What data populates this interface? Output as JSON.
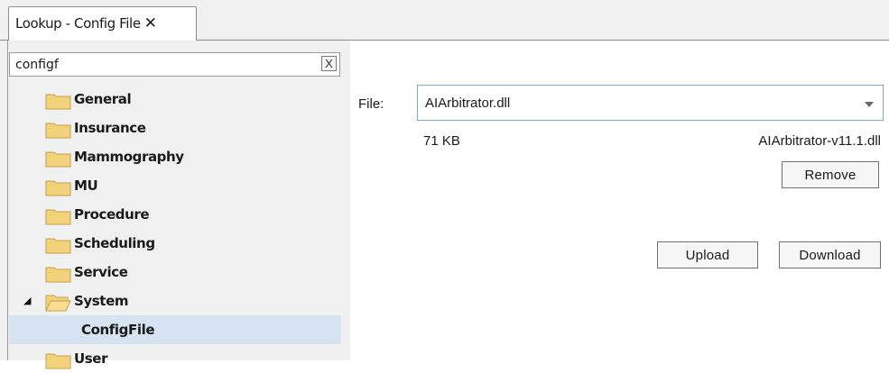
{
  "tab": {
    "title": "Lookup - Config File",
    "close": "✕"
  },
  "search": {
    "value": "configf",
    "clear": "X"
  },
  "tree": {
    "items": [
      {
        "label": "General"
      },
      {
        "label": "Insurance"
      },
      {
        "label": "Mammography"
      },
      {
        "label": "MU"
      },
      {
        "label": "Procedure"
      },
      {
        "label": "Scheduling"
      },
      {
        "label": "Service"
      },
      {
        "label": "System",
        "expanded": true
      },
      {
        "label": "ConfigFile",
        "selected": true
      },
      {
        "label": "User"
      }
    ]
  },
  "file": {
    "label": "File:",
    "selected": "AIArbitrator.dll",
    "size": "71 KB",
    "versioned_name": "AIArbitrator-v11.1.dll"
  },
  "buttons": {
    "remove": "Remove",
    "upload": "Upload",
    "download": "Download"
  },
  "colors": {
    "selection": "#d5e3f3",
    "folder": "#f3d27c",
    "panel": "#f0f0f0"
  }
}
